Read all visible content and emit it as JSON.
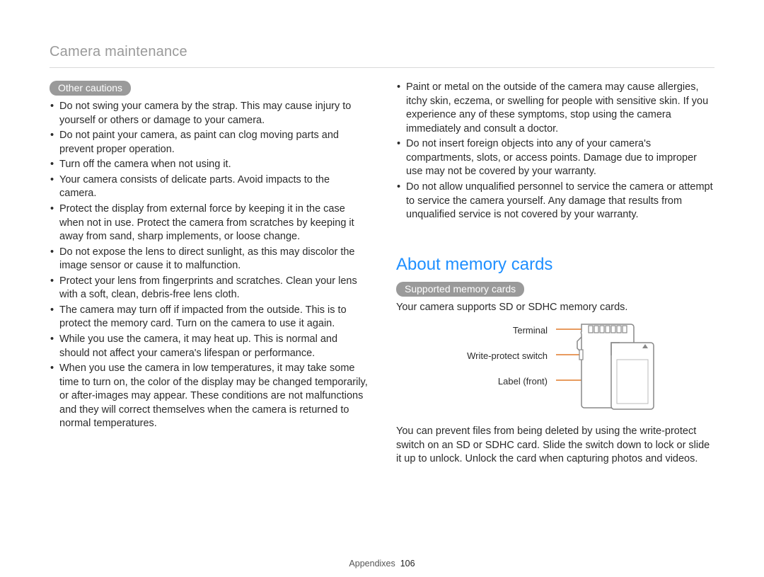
{
  "header": {
    "section_title": "Camera maintenance"
  },
  "left": {
    "pill": "Other cautions",
    "bullets": [
      "Do not swing your camera by the strap. This may cause injury to yourself or others or damage to your camera.",
      "Do not paint your camera, as paint can clog moving parts and prevent proper operation.",
      "Turn off the camera when not using it.",
      "Your camera consists of delicate parts. Avoid impacts to the camera.",
      "Protect the display from external force by keeping it in the case when not in use. Protect the camera from scratches by keeping it away from sand, sharp implements, or loose change.",
      "Do not expose the lens to direct sunlight, as this may discolor the image sensor or cause it to malfunction.",
      "Protect your lens from fingerprints and scratches. Clean your lens with a soft, clean, debris-free lens cloth.",
      "The camera may turn off if impacted from the outside. This is to protect the memory card. Turn on the camera to use it again.",
      "While you use the camera, it may heat up. This is normal and should not affect your camera's lifespan or performance.",
      "When you use the camera in low temperatures, it may take some time to turn on, the color of the display may be changed temporarily, or after-images may appear. These conditions are not malfunctions and they will correct themselves when the camera is returned to normal temperatures."
    ]
  },
  "right": {
    "bullets_top": [
      "Paint or metal on the outside of the camera may cause allergies, itchy skin, eczema, or swelling for people with sensitive skin. If you experience any of these symptoms, stop using the camera immediately and consult a doctor.",
      "Do not insert foreign objects into any of your camera's compartments, slots, or access points. Damage due to improper use may not be covered by your warranty.",
      "Do not allow unqualified personnel to service the camera or attempt to service the camera yourself. Any damage that results from unqualified service is not covered by your warranty."
    ],
    "heading": "About memory cards",
    "pill": "Supported memory cards",
    "intro": "Your camera supports SD or SDHC memory cards.",
    "diagram_labels": {
      "terminal": "Terminal",
      "write_protect": "Write-protect switch",
      "label_front": "Label (front)"
    },
    "outro": "You can prevent files from being deleted by using the write-protect switch on an SD or SDHC card. Slide the switch down to lock or slide it up to unlock. Unlock the card when capturing photos and videos."
  },
  "footer": {
    "label": "Appendixes",
    "page": "106"
  }
}
